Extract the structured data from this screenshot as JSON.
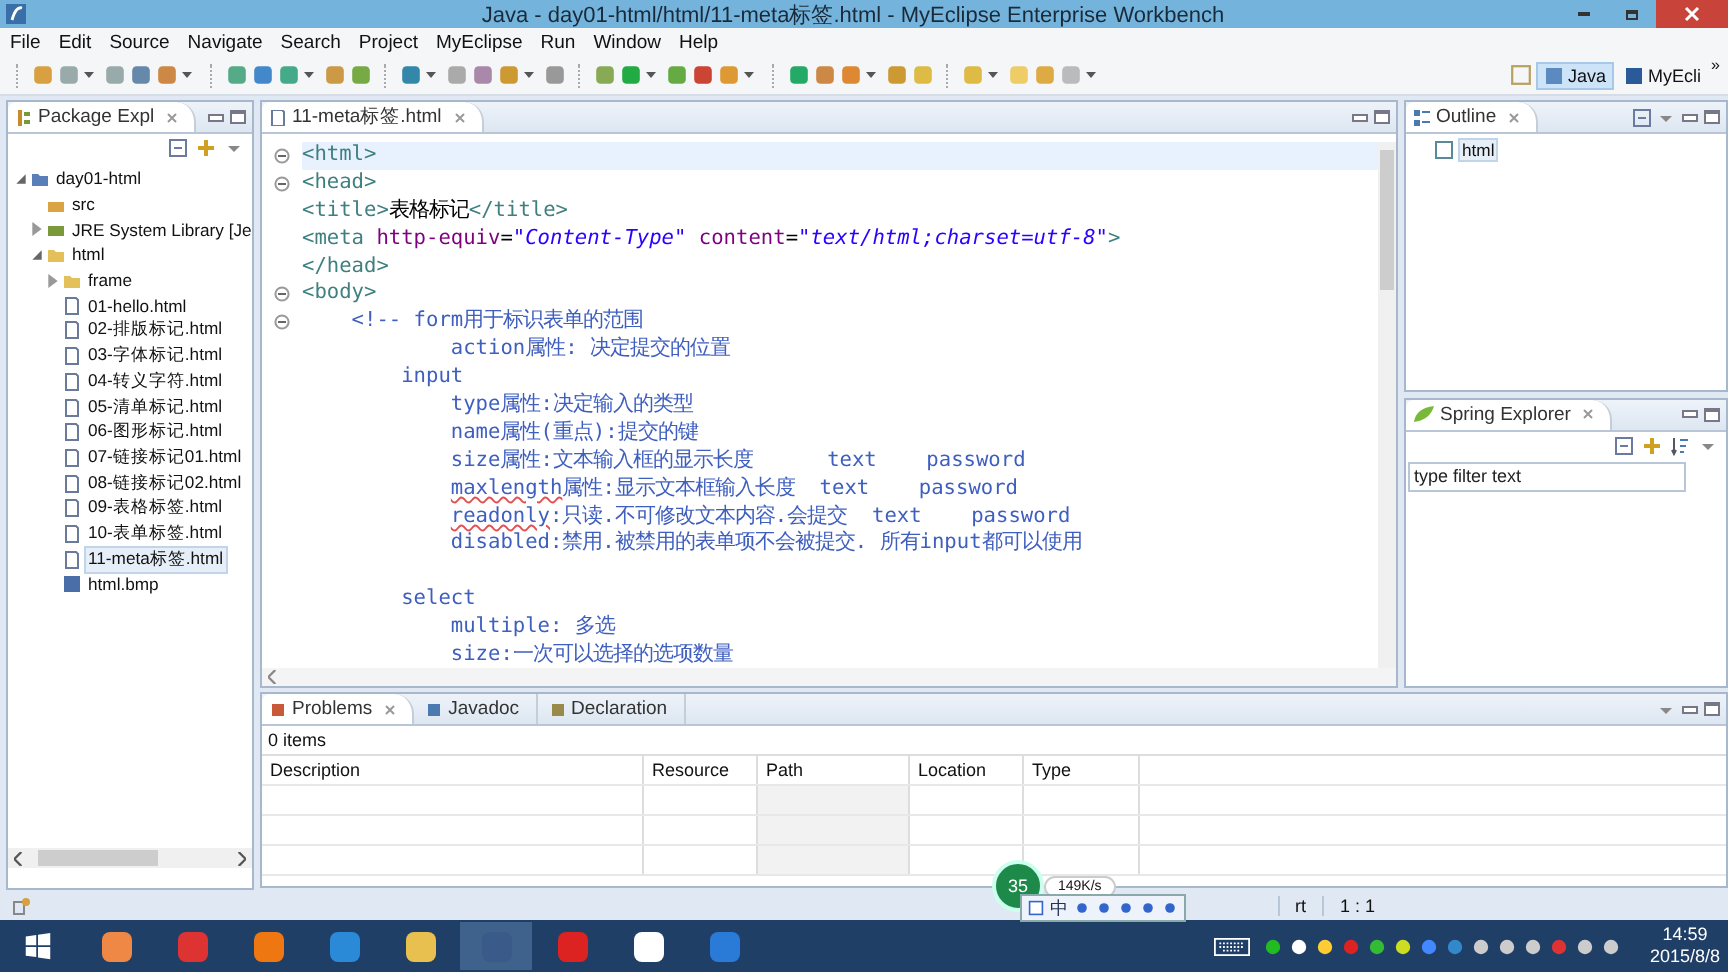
{
  "window": {
    "title": "Java - day01-html/html/11-meta标签.html - MyEclipse Enterprise Workbench"
  },
  "menu": [
    "File",
    "Edit",
    "Source",
    "Navigate",
    "Search",
    "Project",
    "MyEclipse",
    "Run",
    "Window",
    "Help"
  ],
  "perspectives": [
    {
      "label": "Java",
      "selected": true
    },
    {
      "label": "MyEcli",
      "selected": false
    }
  ],
  "perspective_overflow": "»",
  "package_explorer": {
    "title": "Package Expl",
    "tree": [
      {
        "label": "day01-html",
        "kind": "project",
        "expanded": true,
        "selected": false,
        "children": [
          {
            "label": "src",
            "kind": "package",
            "selected": false
          },
          {
            "label": "JRE System Library [Je",
            "kind": "library",
            "expanded": false,
            "selected": false
          },
          {
            "label": "html",
            "kind": "folder",
            "expanded": true,
            "selected": false,
            "children": [
              {
                "label": "frame",
                "kind": "folder",
                "expanded": false,
                "selected": false
              },
              {
                "label": "01-hello.html",
                "kind": "file",
                "selected": false
              },
              {
                "label": "02-排版标记.html",
                "kind": "file",
                "selected": false
              },
              {
                "label": "03-字体标记.html",
                "kind": "file",
                "selected": false
              },
              {
                "label": "04-转义字符.html",
                "kind": "file",
                "selected": false
              },
              {
                "label": "05-清单标记.html",
                "kind": "file",
                "selected": false
              },
              {
                "label": "06-图形标记.html",
                "kind": "file",
                "selected": false
              },
              {
                "label": "07-链接标记01.html",
                "kind": "file",
                "selected": false
              },
              {
                "label": "08-链接标记02.html",
                "kind": "file",
                "selected": false
              },
              {
                "label": "09-表格标签.html",
                "kind": "file",
                "selected": false
              },
              {
                "label": "10-表单标签.html",
                "kind": "file",
                "selected": false
              },
              {
                "label": "11-meta标签.html",
                "kind": "file",
                "selected": true
              },
              {
                "label": "html.bmp",
                "kind": "image",
                "selected": false
              }
            ]
          }
        ]
      }
    ]
  },
  "editor": {
    "tabs": [
      {
        "label": "11-meta标签.html",
        "selected": true
      }
    ],
    "lines": [
      {
        "foldable": true,
        "current": true,
        "segments": [
          {
            "kind": "tag",
            "text": "<html>"
          }
        ]
      },
      {
        "foldable": true,
        "current": false,
        "segments": [
          {
            "kind": "tag",
            "text": "<head>"
          }
        ]
      },
      {
        "current": false,
        "segments": [
          {
            "kind": "tag",
            "text": "<title>"
          },
          {
            "kind": "text",
            "text": "表格标记"
          },
          {
            "kind": "tag",
            "text": "</title>"
          }
        ]
      },
      {
        "current": false,
        "segments": [
          {
            "kind": "tag",
            "text": "<meta "
          },
          {
            "kind": "attr",
            "text": "http-equiv"
          },
          {
            "kind": "text",
            "text": "="
          },
          {
            "kind": "value",
            "text": "\"Content-Type\""
          },
          {
            "kind": "attr",
            "text": " content"
          },
          {
            "kind": "text",
            "text": "="
          },
          {
            "kind": "value",
            "text": "\"text/html;charset=utf-8\""
          },
          {
            "kind": "tag",
            "text": ">"
          }
        ]
      },
      {
        "current": false,
        "segments": [
          {
            "kind": "tag",
            "text": "</head>"
          }
        ]
      },
      {
        "foldable": true,
        "current": false,
        "segments": [
          {
            "kind": "tag",
            "text": "<body>"
          }
        ]
      },
      {
        "foldable": true,
        "current": false,
        "segments": [
          {
            "kind": "comment",
            "text": "    <!-- form用于标识表单的范围"
          }
        ]
      },
      {
        "current": false,
        "segments": [
          {
            "kind": "comment",
            "text": "            action属性: 决定提交的位置"
          }
        ]
      },
      {
        "current": false,
        "segments": [
          {
            "kind": "comment",
            "text": "        input"
          }
        ]
      },
      {
        "current": false,
        "segments": [
          {
            "kind": "comment",
            "text": "            type属性:决定输入的类型"
          }
        ]
      },
      {
        "current": false,
        "segments": [
          {
            "kind": "comment",
            "text": "            name属性(重点):提交的键"
          }
        ]
      },
      {
        "current": false,
        "segments": [
          {
            "kind": "comment",
            "text": "            size属性:文本输入框的显示长度      text    password"
          }
        ]
      },
      {
        "current": false,
        "segments": [
          {
            "kind": "misspelled",
            "text": "            maxlength"
          },
          {
            "kind": "comment",
            "text": "属性:显示文本框输入长度  text    password"
          }
        ]
      },
      {
        "current": false,
        "segments": [
          {
            "kind": "misspelled",
            "text": "            readonly"
          },
          {
            "kind": "comment",
            "text": ":只读.不可修改文本内容.会提交  text    password"
          }
        ]
      },
      {
        "current": false,
        "segments": [
          {
            "kind": "comment",
            "text": "            disabled:禁用.被禁用的表单项不会被提交. 所有input都可以使用"
          }
        ]
      },
      {
        "current": false,
        "gap_before": true,
        "segments": [
          {
            "kind": "comment",
            "text": "        select"
          }
        ]
      },
      {
        "current": false,
        "segments": [
          {
            "kind": "comment",
            "text": "            multiple: 多选"
          }
        ]
      },
      {
        "current": false,
        "segments": [
          {
            "kind": "comment",
            "text": "            size:一次可以选择的选项数量"
          }
        ]
      }
    ]
  },
  "outline": {
    "title": "Outline",
    "items": [
      {
        "label": "html",
        "selected": true
      }
    ]
  },
  "spring_explorer": {
    "title": "Spring Explorer",
    "filter": {
      "placeholder": "type filter text"
    }
  },
  "bottom_panel": {
    "tabs": [
      {
        "label": "Problems",
        "selected": true
      },
      {
        "label": "Javadoc",
        "selected": false
      },
      {
        "label": "Declaration",
        "selected": false
      }
    ],
    "summary": "0 items",
    "columns": [
      "Description",
      "Resource",
      "Path",
      "Location",
      "Type"
    ]
  },
  "status_bar": {
    "insert_mode": "rt",
    "position": "1 : 1"
  },
  "net_monitor": {
    "cpu": "35",
    "speed": "149K/s"
  },
  "ime_bar": {
    "mode": "中"
  },
  "taskbar": {
    "time": "14:59",
    "date": "2015/8/8"
  }
}
